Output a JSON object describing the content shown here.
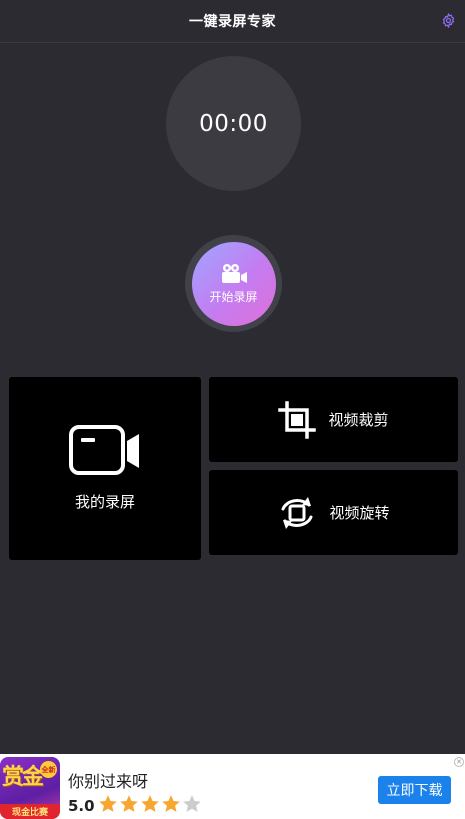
{
  "header": {
    "title": "一键录屏专家",
    "settings_icon": "gear-icon"
  },
  "timer": {
    "value": "00:00"
  },
  "record": {
    "label": "开始录屏",
    "icon": "video-camera-icon"
  },
  "tiles": {
    "my_recordings": {
      "label": "我的录屏",
      "icon": "video-icon"
    },
    "video_crop": {
      "label": "视频裁剪",
      "icon": "crop-icon"
    },
    "video_rotate": {
      "label": "视频旋转",
      "icon": "rotate-icon"
    }
  },
  "ad": {
    "logo_text": "赏金",
    "logo_badge": "全新",
    "logo_strip": "现金比赛",
    "title": "你别过来呀",
    "rating": "5.0",
    "stars_filled": 4,
    "stars_total": 5,
    "button_label": "立即下载",
    "close_glyph": "✕"
  },
  "colors": {
    "background": "#2b2b31",
    "tile": "#000000",
    "accent_purple": "#8e6cf0",
    "ad_button": "#1a82ea",
    "star_filled": "#f7a631",
    "star_empty": "#cccccc"
  }
}
